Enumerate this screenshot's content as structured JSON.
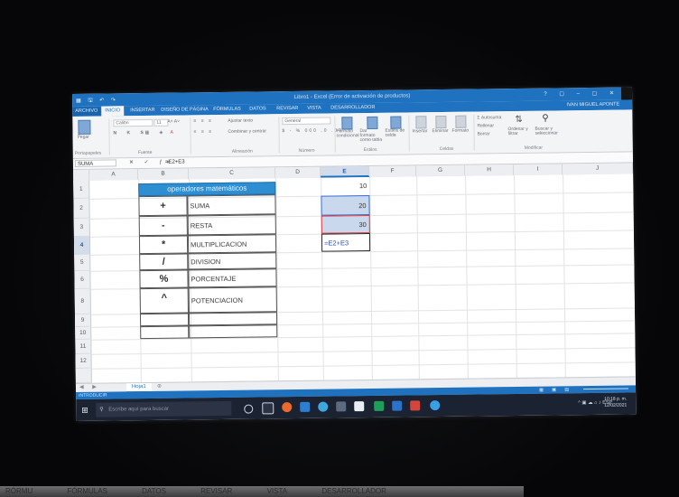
{
  "bottom_strip": [
    "RÓRMU",
    "FÓRMULAS",
    "DATOS",
    "REVISAR",
    "VISTA",
    "DESARROLLADOR"
  ],
  "window": {
    "title": "Libro1 - Excel (Error de activación de productos)",
    "user": "IVAN MIGUEL APONTE",
    "winbtns": "? ▢ – ▢ ✕"
  },
  "tabs": [
    "ARCHIVO",
    "INICIO",
    "INSERTAR",
    "DISEÑO DE PÁGINA",
    "FÓRMULAS",
    "DATOS",
    "REVISAR",
    "VISTA",
    "DESARROLLADOR"
  ],
  "ribbon": {
    "paste": "Pegar",
    "clipboard": "Portapapeles",
    "font_name": "Calibri",
    "font_size": "11",
    "font": "Fuente",
    "wrap": "Ajustar texto",
    "merge": "Combinar y centrar",
    "alignment": "Alineación",
    "number_format": "General",
    "number": "Número",
    "conditional": "Formato condicional",
    "as_table": "Dar formato como tabla",
    "cell_styles": "Estilos de celda",
    "styles": "Estilos",
    "insert": "Insertar",
    "delete": "Eliminar",
    "format": "Formato",
    "cells": "Celdas",
    "autosum": "Autosuma",
    "fill": "Rellenar",
    "clear": "Borrar",
    "sort": "Ordenar y filtrar",
    "find": "Buscar y seleccionar",
    "editing": "Modificar"
  },
  "formula_bar": {
    "name_box": "SUMA",
    "formula": "=E2+E3"
  },
  "columns": [
    "A",
    "B",
    "C",
    "D",
    "E",
    "F",
    "G",
    "H",
    "I",
    "J"
  ],
  "rows": [
    "1",
    "2",
    "3",
    "4",
    "5",
    "6",
    "8",
    "9",
    "10",
    "11",
    "12"
  ],
  "table": {
    "header": "operadores matemáticos",
    "items": [
      {
        "symbol": "+",
        "name": "SUMA"
      },
      {
        "symbol": "-",
        "name": "RESTA"
      },
      {
        "symbol": "*",
        "name": "MULTIPLICACION"
      },
      {
        "symbol": "/",
        "name": "DIVISION"
      },
      {
        "symbol": "%",
        "name": "PORCENTAJE"
      },
      {
        "symbol": "^",
        "name": "POTENCIACION"
      }
    ]
  },
  "column_e": {
    "e1": "10",
    "e2": "20",
    "e3": "30",
    "e4_formula": "=E2+E3"
  },
  "sheet": {
    "tab": "Hoja1",
    "add": "⊕"
  },
  "status": {
    "mode": "INTRODUCIR"
  },
  "taskbar": {
    "search_placeholder": "Escribe aquí para buscar",
    "tray": "^ ▣ ☁ ⌂ ♪ ESP",
    "time": "10:18 p. m.",
    "date": "12/02/2021"
  }
}
